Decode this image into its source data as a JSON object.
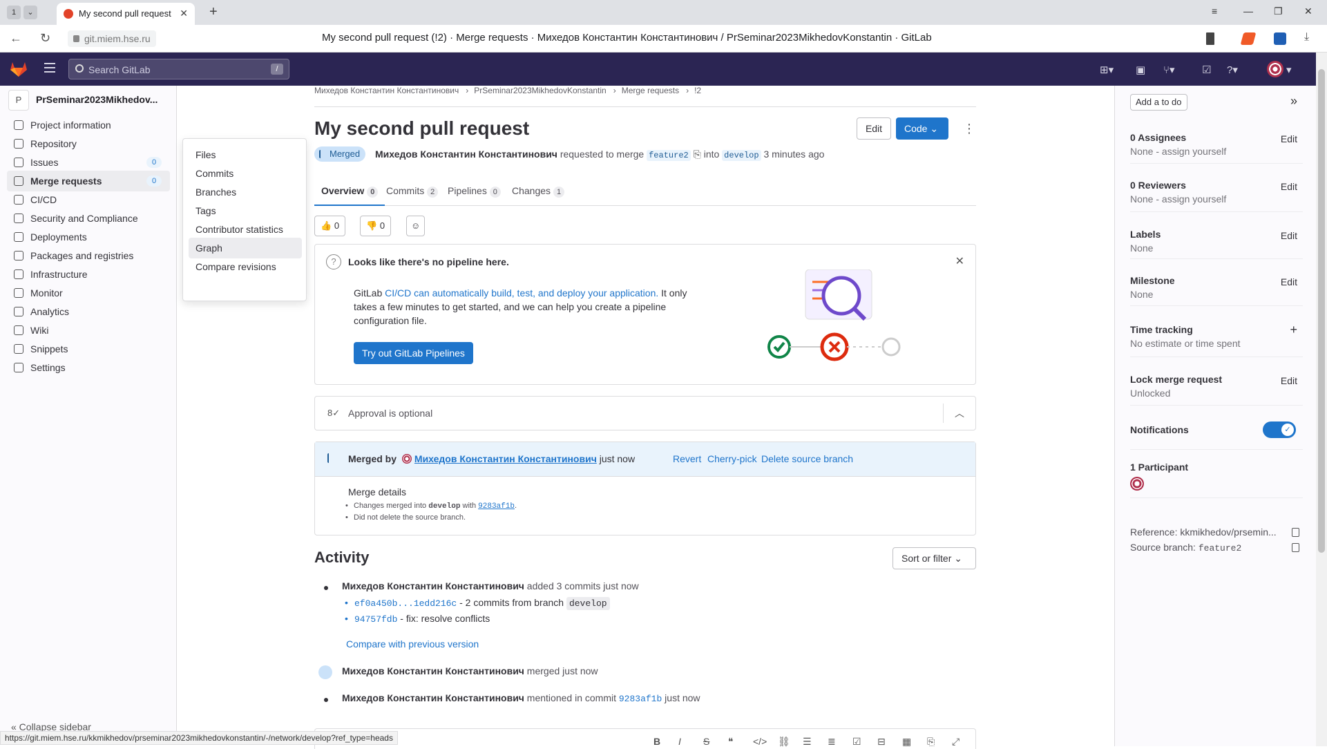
{
  "browser": {
    "tab_count": "1",
    "tab_title": "My second pull request",
    "url": "git.miem.hse.ru",
    "page_title": "My second pull request (!2) · Merge requests · Михедов Константин Константинович / PrSeminar2023MikhedovKonstantin · GitLab",
    "status_url": "https://git.miem.hse.ru/kkmikhedov/prseminar2023mikhedovkonstantin/-/network/develop?ref_type=heads"
  },
  "header": {
    "search_placeholder": "Search GitLab",
    "search_shortcut": "/"
  },
  "sidebar": {
    "project_initial": "P",
    "project_name": "PrSeminar2023Mikhedov...",
    "items": [
      {
        "label": "Project information"
      },
      {
        "label": "Repository"
      },
      {
        "label": "Issues",
        "count": "0"
      },
      {
        "label": "Merge requests",
        "count": "0"
      },
      {
        "label": "CI/CD"
      },
      {
        "label": "Security and Compliance"
      },
      {
        "label": "Deployments"
      },
      {
        "label": "Packages and registries"
      },
      {
        "label": "Infrastructure"
      },
      {
        "label": "Monitor"
      },
      {
        "label": "Analytics"
      },
      {
        "label": "Wiki"
      },
      {
        "label": "Snippets"
      },
      {
        "label": "Settings"
      }
    ],
    "collapse_label": "« Collapse sidebar"
  },
  "flyout": {
    "items": [
      "Files",
      "Commits",
      "Branches",
      "Tags",
      "Contributor statistics",
      "Graph",
      "Compare revisions"
    ]
  },
  "breadcrumb": [
    "Михедов Константин Константинович",
    "PrSeminar2023MikhedovKonstantin",
    "Merge requests",
    "!2"
  ],
  "mr": {
    "title": "My second pull request",
    "edit_label": "Edit",
    "code_label": "Code",
    "status": "Merged",
    "author": "Михедов Константин Константинович",
    "requested_to_merge": "requested to merge",
    "source_branch": "feature2",
    "into": "into",
    "target_branch": "develop",
    "time": "3 minutes ago",
    "tabs": [
      {
        "label": "Overview",
        "count": "0"
      },
      {
        "label": "Commits",
        "count": "2"
      },
      {
        "label": "Pipelines",
        "count": "0"
      },
      {
        "label": "Changes",
        "count": "1"
      }
    ],
    "thumbs_up": "0",
    "thumbs_down": "0"
  },
  "pipeline_card": {
    "title": "Looks like there's no pipeline here.",
    "text_prefix": "GitLab ",
    "text_link": "CI/CD can automatically build, test, and deploy your application.",
    "text_suffix": " It only takes a few minutes to get started, and we can help you create a pipeline configuration file.",
    "button": "Try out GitLab Pipelines"
  },
  "approval": {
    "text": "Approval is optional"
  },
  "merge_widget": {
    "merged_by": "Merged by",
    "user": "Михедов Константин Константинович",
    "when": "just now",
    "actions": [
      "Revert",
      "Cherry-pick",
      "Delete source branch"
    ],
    "details_title": "Merge details",
    "detail1_prefix": "Changes merged into ",
    "detail1_branch": "develop",
    "detail1_with": " with ",
    "detail1_sha": "9283af1b",
    "detail1_end": ".",
    "detail2": "Did not delete the source branch."
  },
  "activity": {
    "title": "Activity",
    "sort_label": "Sort or filter",
    "row1_user": "Михедов Константин Константинович",
    "row1_text": " added 3 commits just now",
    "commit1_sha": "ef0a450b...1edd216c",
    "commit1_text": " - 2 commits from branch ",
    "commit1_branch": "develop",
    "commit2_sha": "94757fdb",
    "commit2_text": " - fix: resolve conflicts",
    "compare_link": "Compare with previous version",
    "row2_user": "Михедов Константин Константинович",
    "row2_text": " merged just now",
    "row3_user": "Михедов Константин Константинович",
    "row3_text": " mentioned in commit ",
    "row3_sha": "9283af1b",
    "row3_end": " just now"
  },
  "right_sidebar": {
    "todo": "Add a to do",
    "assignees_title": "0 Assignees",
    "assignees_value": "None - assign yourself",
    "reviewers_title": "0 Reviewers",
    "reviewers_value": "None - assign yourself",
    "labels_title": "Labels",
    "labels_value": "None",
    "milestone_title": "Milestone",
    "milestone_value": "None",
    "time_title": "Time tracking",
    "time_value": "No estimate or time spent",
    "lock_title": "Lock merge request",
    "lock_value": "Unlocked",
    "notifications_title": "Notifications",
    "notifications_on": true,
    "participants_title": "1 Participant",
    "reference_label": "Reference: ",
    "reference_value": "kkmikhedov/prsemin...",
    "source_label": "Source branch: ",
    "source_value": "feature2",
    "edit": "Edit",
    "add": "+"
  },
  "colors": {
    "header_bg": "#2b2553",
    "accent": "#1f75cb",
    "merged_badge": "#cbe2f9"
  }
}
